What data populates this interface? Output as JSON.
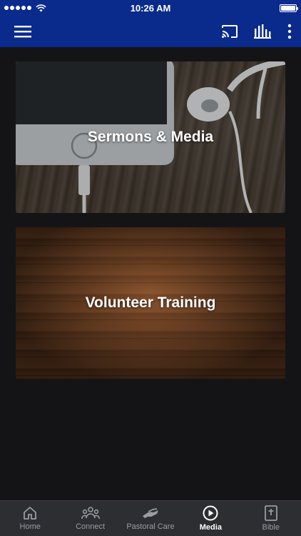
{
  "status_bar": {
    "time": "10:26 AM"
  },
  "app_bar": {
    "menu_icon": "hamburger-menu-icon",
    "cast_icon": "cast-icon",
    "audio_icon": "audio-bars-icon",
    "more_icon": "more-vertical-icon"
  },
  "cards": [
    {
      "title": "Sermons & Media"
    },
    {
      "title": "Volunteer Training"
    }
  ],
  "tabs": [
    {
      "label": "Home",
      "icon": "home-icon",
      "active": false
    },
    {
      "label": "Connect",
      "icon": "people-icon",
      "active": false
    },
    {
      "label": "Pastoral Care",
      "icon": "helping-hand-icon",
      "active": false
    },
    {
      "label": "Media",
      "icon": "play-circle-icon",
      "active": true
    },
    {
      "label": "Bible",
      "icon": "bible-icon",
      "active": false
    }
  ],
  "colors": {
    "header": "#0a2b8c",
    "background": "#141416",
    "tab_bar": "#2d2e32"
  }
}
